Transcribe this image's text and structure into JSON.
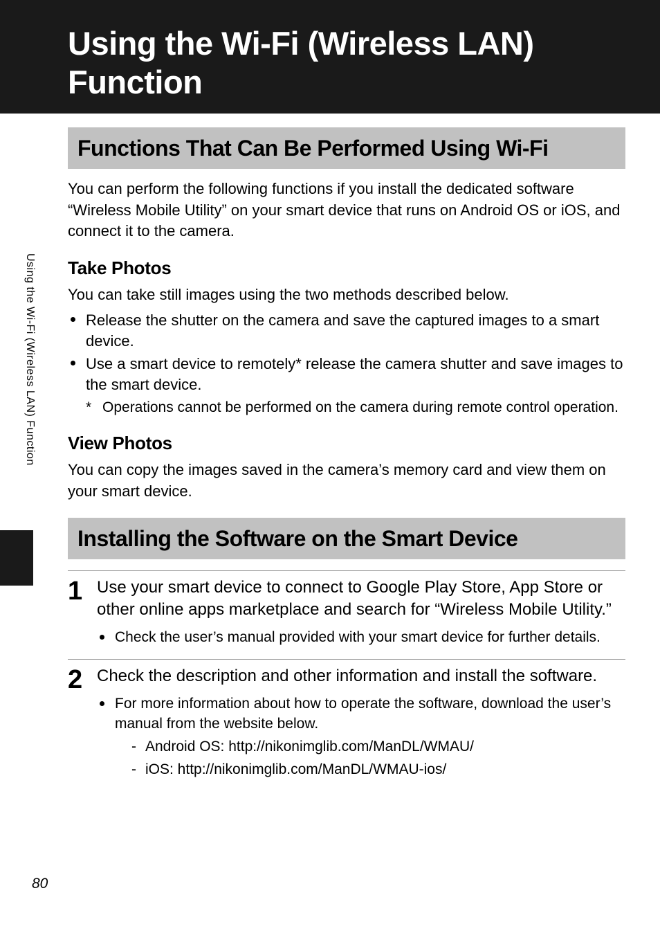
{
  "page": {
    "title": "Using the Wi-Fi (Wireless LAN) Function",
    "number": "80"
  },
  "sidebar": {
    "tab_text": "Using the Wi-Fi (Wireless LAN) Function"
  },
  "section1": {
    "header": "Functions That Can Be Performed Using Wi-Fi",
    "intro": "You can perform the following functions if you install the dedicated software “Wireless Mobile Utility” on your smart device that runs on Android OS or iOS, and connect it to the camera.",
    "sub1": {
      "header": "Take Photos",
      "intro": "You can take still images using the two methods described below.",
      "bullets": [
        "Release the shutter on the camera and save the captured images to a smart device.",
        "Use a smart device to remotely* release the camera shutter and save images to the smart device."
      ],
      "footnote_mark": "*",
      "footnote": "Operations cannot be performed on the camera during remote control operation."
    },
    "sub2": {
      "header": "View Photos",
      "body": "You can copy the images saved in the camera’s memory card and view them on your smart device."
    }
  },
  "section2": {
    "header": "Installing the Software on the Smart Device",
    "steps": [
      {
        "num": "1",
        "text": "Use your smart device to connect to Google Play Store, App Store or other online apps marketplace and search for “Wireless Mobile Utility.”",
        "bullets": [
          "Check the user’s manual provided with your smart device for further details."
        ],
        "nested": []
      },
      {
        "num": "2",
        "text": "Check the description and other information and install the software.",
        "bullets": [
          "For more information about how to operate the software, download the user’s manual from the website below."
        ],
        "nested": [
          "Android OS: http://nikonimglib.com/ManDL/WMAU/",
          "iOS: http://nikonimglib.com/ManDL/WMAU-ios/"
        ]
      }
    ]
  }
}
